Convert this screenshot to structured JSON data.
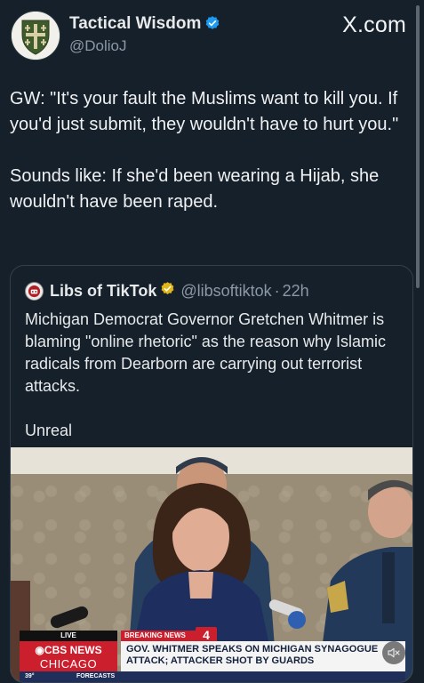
{
  "header": {
    "display_name": "Tactical Wisdom",
    "handle": "@DolioJ",
    "site_label": "X.com"
  },
  "tweet": {
    "text": "GW: \"It's your fault the Muslims want to kill you. If you'd just submit, they wouldn't have to hurt you.\"\n\nSounds like: If she'd been wearing a Hijab, she wouldn't have been raped."
  },
  "quote": {
    "display_name": "Libs of TikTok",
    "handle": "@libsoftiktok",
    "separator": "·",
    "time": "22h",
    "text": "Michigan Democrat Governor Gretchen Whitmer is blaming \"online rhetoric\" as the reason why Islamic radicals from Dearborn are carrying out terrorist attacks.\n\nUnreal"
  },
  "video": {
    "live_tag": "LIVE",
    "brand_top": "CBS NEWS",
    "brand_bottom": "CHICAGO",
    "breaking_tag": "BREAKING NEWS",
    "channel": "4",
    "headline": "GOV. WHITMER SPEAKS ON MICHIGAN SYNAGOGUE ATTACK; ATTACKER SHOT BY GUARDS",
    "temperature": "39°",
    "forecasts_label": "FORECASTS"
  },
  "colors": {
    "background": "#15202b",
    "verified": "#1d9bf0",
    "gold_verified": "#e2b719",
    "cbs_red": "#cc1f2d"
  },
  "icons": {
    "verified": "verified-badge-icon",
    "gold_verified": "gold-verified-badge-icon",
    "mute": "muted-speaker-icon"
  }
}
